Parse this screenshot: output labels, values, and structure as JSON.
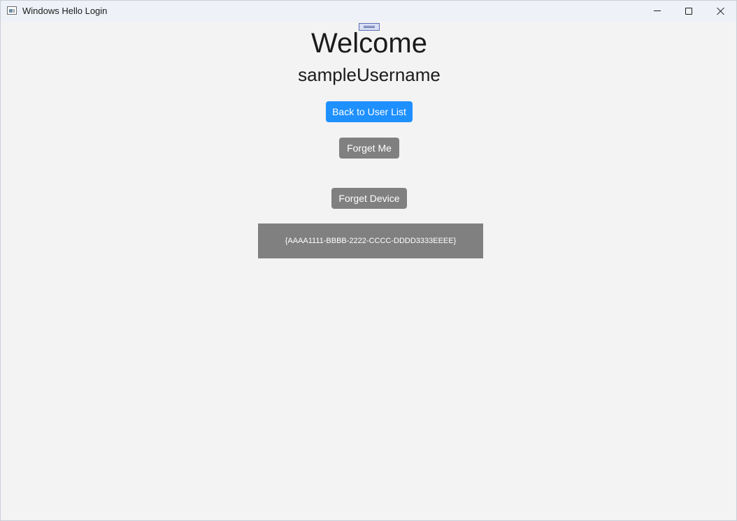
{
  "window": {
    "title": "Windows Hello Login",
    "controls": {
      "minimize": "minimize-icon",
      "maximize": "maximize-icon",
      "close": "close-icon"
    }
  },
  "main": {
    "heading": "Welcome",
    "username": "sampleUsername",
    "back_button_label": "Back to User List",
    "forget_me_label": "Forget Me",
    "forget_device_label": "Forget Device",
    "device_id": "{AAAA1111-BBBB-2222-CCCC-DDDD3333EEEE}"
  },
  "colors": {
    "accent": "#1e90ff",
    "secondary_button": "#808080",
    "background": "#f3f3f3"
  }
}
